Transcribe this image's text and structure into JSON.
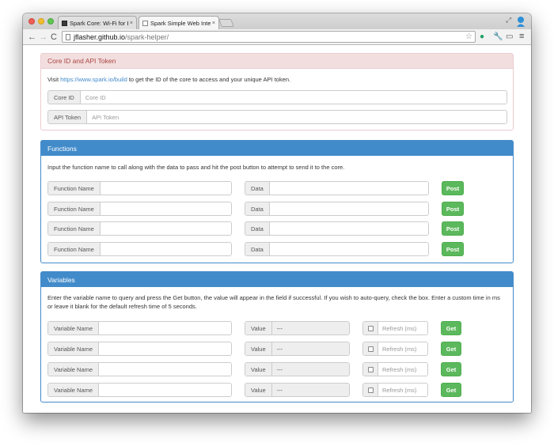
{
  "browser": {
    "tabs": [
      {
        "title": "Spark Core: Wi-Fi for Everyth",
        "close": "×",
        "active": false
      },
      {
        "title": "Spark Simple Web Interface",
        "close": "×",
        "active": true
      }
    ],
    "url_host": "jflasher.github.io",
    "url_path": "/spark-helper/",
    "icons": {
      "back": "←",
      "forward": "→",
      "reload": "C",
      "star": "☆",
      "leaf": "●",
      "wrench": "🔧",
      "cast": "▭",
      "menu": "≡",
      "expand": "⤢"
    },
    "colors": {
      "profile_badge": "#2e8fd8",
      "extension_leaf": "#1aa260"
    }
  },
  "core_panel": {
    "title": "Core ID and API Token",
    "intro_before": "Visit ",
    "intro_link": "https://www.spark.io/build",
    "intro_after": " to get the ID of the core to access and your unique API token.",
    "core_id_label": "Core ID",
    "core_id_placeholder": "Core ID",
    "api_token_label": "API Token",
    "api_token_placeholder": "API Token"
  },
  "functions_panel": {
    "title": "Functions",
    "intro": "Input the function name to call along with the data to pass and hit the post button to attempt to send it to the core.",
    "rows": [
      {
        "name_label": "Function Name",
        "data_label": "Data",
        "button": "Post"
      },
      {
        "name_label": "Function Name",
        "data_label": "Data",
        "button": "Post"
      },
      {
        "name_label": "Function Name",
        "data_label": "Data",
        "button": "Post"
      },
      {
        "name_label": "Function Name",
        "data_label": "Data",
        "button": "Post"
      }
    ]
  },
  "variables_panel": {
    "title": "Variables",
    "intro_line1": "Enter the variable name to query and press the Get button, the value will appear in the field if successful. If you wish to auto-query, check the box. Enter a custom time in ms",
    "intro_line2": "or leave it blank for the default refresh time of 5 seconds.",
    "rows": [
      {
        "name_label": "Variable Name",
        "value_label": "Value",
        "value": "---",
        "refresh_placeholder": "Refresh (ms)",
        "checked": false,
        "button": "Get"
      },
      {
        "name_label": "Variable Name",
        "value_label": "Value",
        "value": "---",
        "refresh_placeholder": "Refresh (ms)",
        "checked": false,
        "button": "Get"
      },
      {
        "name_label": "Variable Name",
        "value_label": "Value",
        "value": "---",
        "refresh_placeholder": "Refresh (ms)",
        "checked": false,
        "button": "Get"
      },
      {
        "name_label": "Variable Name",
        "value_label": "Value",
        "value": "---",
        "refresh_placeholder": "Refresh (ms)",
        "checked": false,
        "button": "Get"
      }
    ]
  }
}
